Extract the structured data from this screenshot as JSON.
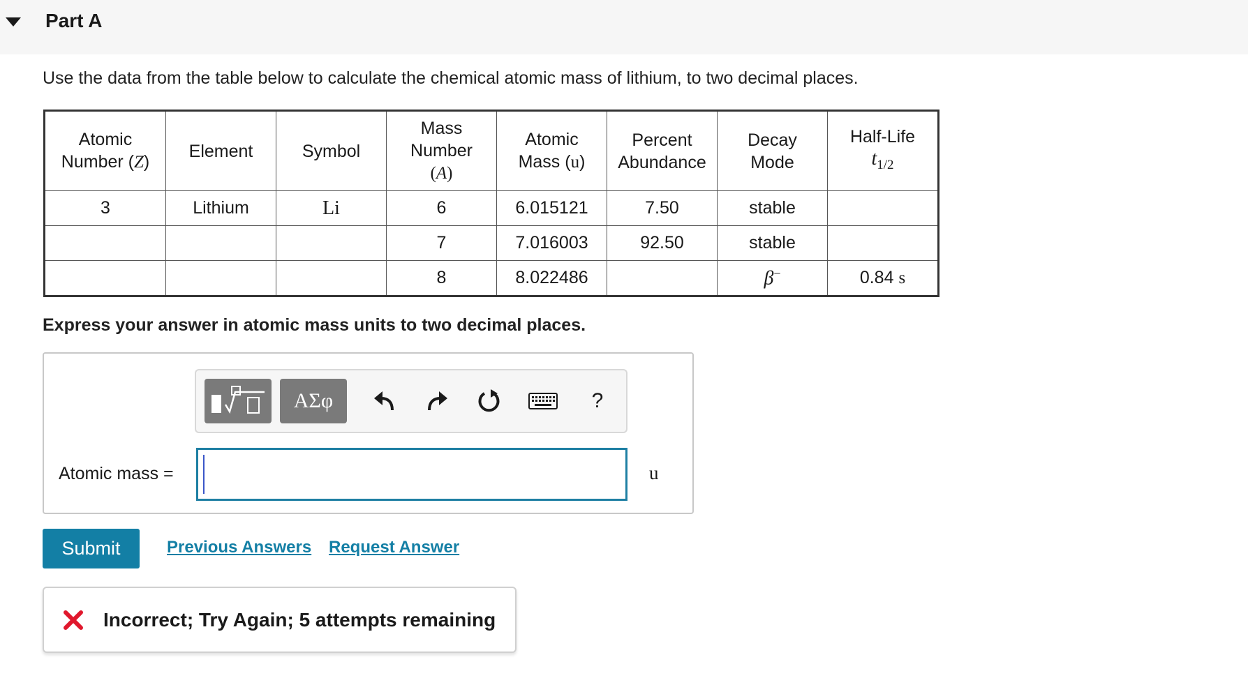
{
  "part": {
    "title": "Part A"
  },
  "prompt": "Use the data from the table below to calculate the chemical atomic mass of lithium, to two decimal places.",
  "table": {
    "headers": {
      "atomic_number": {
        "line1": "Atomic",
        "line2": "Number (",
        "var": "Z",
        "close": ")"
      },
      "element": "Element",
      "symbol": "Symbol",
      "mass_number": {
        "line1": "Mass",
        "line2": "Number",
        "var": "A"
      },
      "atomic_mass": {
        "line1": "Atomic",
        "line2": "Mass (",
        "unit": "u",
        "close": ")"
      },
      "percent_abundance": {
        "line1": "Percent",
        "line2": "Abundance"
      },
      "decay_mode": {
        "line1": "Decay",
        "line2": "Mode"
      },
      "half_life": {
        "line1": "Half-Life",
        "var": "t",
        "sub": "1/2"
      }
    },
    "rows": [
      {
        "atomic_number": "3",
        "element": "Lithium",
        "symbol": "Li",
        "mass_number": "6",
        "atomic_mass": "6.015121",
        "abundance": "7.50",
        "decay": "stable",
        "half_life_value": "",
        "half_life_unit": ""
      },
      {
        "atomic_number": "",
        "element": "",
        "symbol": "",
        "mass_number": "7",
        "atomic_mass": "7.016003",
        "abundance": "92.50",
        "decay": "stable",
        "half_life_value": "",
        "half_life_unit": ""
      },
      {
        "atomic_number": "",
        "element": "",
        "symbol": "",
        "mass_number": "8",
        "atomic_mass": "8.022486",
        "abundance": "",
        "decay": "β",
        "decay_sup": "−",
        "half_life_value": "0.84",
        "half_life_unit": "s"
      }
    ]
  },
  "instruction": "Express your answer in atomic mass units to two decimal places.",
  "answer": {
    "label": "Atomic mass =",
    "value": "",
    "unit": "u",
    "toolbar": {
      "greek_label": "ΑΣφ",
      "help_label": "?"
    }
  },
  "actions": {
    "submit_label": "Submit",
    "previous_answers_label": "Previous Answers",
    "request_answer_label": "Request Answer"
  },
  "feedback": {
    "message": "Incorrect; Try Again; 5 attempts remaining",
    "status_color": "#e0182d"
  },
  "colors": {
    "accent": "#137fa5",
    "toolbar_button": "#7a7a7a"
  }
}
